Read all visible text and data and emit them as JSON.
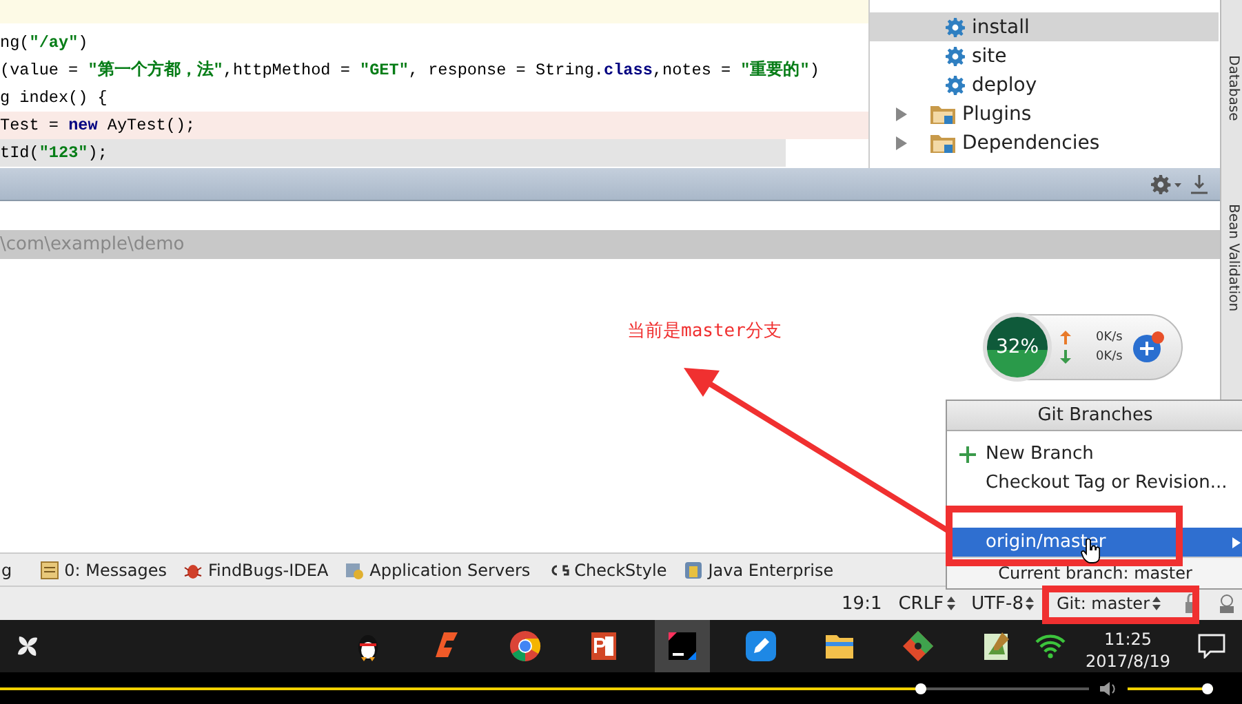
{
  "editor": {
    "lines": [
      {
        "kind": "current"
      },
      {
        "kind": "plain",
        "tokens": [
          {
            "kind": "plain",
            "text": "ng("
          },
          {
            "kind": "string",
            "text": "\"/ay\""
          },
          {
            "kind": "plain",
            "text": ")"
          }
        ]
      },
      {
        "kind": "plain",
        "tokens": [
          {
            "kind": "plain",
            "text": "(value = "
          },
          {
            "kind": "string",
            "text": "\"第一个方都，法\""
          },
          {
            "kind": "plain",
            "text": ",httpMethod = "
          },
          {
            "kind": "string",
            "text": "\"GET\""
          },
          {
            "kind": "plain",
            "text": ", response = String."
          },
          {
            "kind": "keyword",
            "text": "class"
          },
          {
            "kind": "plain",
            "text": ",notes = "
          },
          {
            "kind": "string",
            "text": "\"重要的\""
          },
          {
            "kind": "plain",
            "text": ")"
          }
        ]
      },
      {
        "kind": "plain",
        "tokens": [
          {
            "kind": "plain",
            "text": "g index() {"
          }
        ]
      },
      {
        "kind": "breakpoint",
        "tokens": [
          {
            "kind": "plain",
            "text": "Test = "
          },
          {
            "kind": "keyword",
            "text": "new"
          },
          {
            "kind": "plain",
            "text": " AyTest();"
          }
        ]
      },
      {
        "kind": "selection",
        "tokens": [
          {
            "kind": "plain",
            "text": "tId("
          },
          {
            "kind": "string",
            "text": "\"123\""
          },
          {
            "kind": "plain",
            "text": ");"
          }
        ]
      }
    ]
  },
  "maven_tree": [
    {
      "kind": "goal",
      "label": "install",
      "selected": true
    },
    {
      "kind": "goal",
      "label": "site",
      "selected": false
    },
    {
      "kind": "goal",
      "label": "deploy",
      "selected": false
    },
    {
      "kind": "folder",
      "label": "Plugins",
      "expanded": false
    },
    {
      "kind": "folder",
      "label": "Dependencies",
      "expanded": false
    }
  ],
  "right_tool_tabs": [
    "Database",
    "Bean Validation"
  ],
  "path_bar": "\\com\\example\\demo",
  "annotation": "当前是master分支",
  "network_widget": {
    "percent": "32%",
    "upload": "0K/s",
    "download": "0K/s"
  },
  "git_branches_popup": {
    "title": "Git Branches",
    "items": [
      {
        "kind": "action",
        "label": "New Branch",
        "selected": false
      },
      {
        "kind": "plain",
        "label": "Checkout Tag or Revision...",
        "selected": false
      },
      {
        "kind": "branch",
        "label": "origin/master",
        "selected": true
      }
    ],
    "footer": "Current branch: master"
  },
  "tool_strip": [
    {
      "kind": "cut",
      "label": "g"
    },
    {
      "kind": "messages",
      "label": "0: Messages"
    },
    {
      "kind": "findbugs",
      "label": "FindBugs-IDEA"
    },
    {
      "kind": "servers",
      "label": "Application Servers"
    },
    {
      "kind": "checkstyle",
      "label": "CheckStyle"
    },
    {
      "kind": "enterprise",
      "label": "Java Enterprise"
    }
  ],
  "status_bar": {
    "position": "19:1",
    "line_ending": "CRLF",
    "encoding": "UTF-8",
    "vcs": "Git: master"
  },
  "taskbar": {
    "apps": [
      {
        "kind": "penguin",
        "active": false
      },
      {
        "kind": "flame",
        "active": false
      },
      {
        "kind": "browser",
        "active": false
      },
      {
        "kind": "slides",
        "active": false
      },
      {
        "kind": "ide",
        "active": true
      },
      {
        "kind": "pen",
        "active": false
      },
      {
        "kind": "folder",
        "active": false
      },
      {
        "kind": "git",
        "active": false
      },
      {
        "kind": "notepad",
        "active": false
      }
    ],
    "time": "11:25",
    "date": "2017/8/19"
  },
  "video_player": {
    "progress": {
      "level": 0.85
    },
    "volume": {
      "level": 1
    }
  }
}
